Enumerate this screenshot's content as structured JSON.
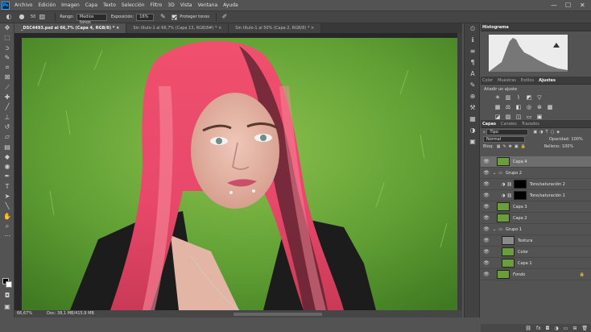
{
  "app": {
    "logo": "Ps"
  },
  "menu": [
    "Archivo",
    "Edición",
    "Imagen",
    "Capa",
    "Texto",
    "Selección",
    "Filtro",
    "3D",
    "Vista",
    "Ventana",
    "Ayuda"
  ],
  "window_controls": {
    "minimize": "—",
    "maximize": "☐",
    "close": "✕"
  },
  "options": {
    "brush_size": "50",
    "range_label": "Rango:",
    "range_value": "Medios tonos",
    "exposure_label": "Exposición:",
    "exposure_value": "16%",
    "protect_label": "Proteger tonos"
  },
  "doc_tabs": [
    {
      "label": "_DSC4493.psd al 66,7% (Capa 4, RGB/8) * ×"
    },
    {
      "label": "Sin título-1 al 66,7% (Capa 13, RGB/8#) * ×"
    },
    {
      "label": "Sin título-1 al 50% (Capa 2, RGB/8) * ×"
    }
  ],
  "status": {
    "zoom": "66,67%",
    "doc": "Doc: 38,1 MB/415,9 MB"
  },
  "histogram": {
    "tab": "Histograma"
  },
  "adjust": {
    "tabs": [
      "Color",
      "Muestras",
      "Estilos",
      "Ajustes"
    ],
    "title": "Añadir un ajuste"
  },
  "layers_panel": {
    "tabs": [
      "Capas",
      "Canales",
      "Trazados"
    ],
    "filter_label": "Tipo",
    "blend_mode": "Normal",
    "opacity_label": "Opacidad:",
    "opacity_value": "100%",
    "lock_label": "Bloq:",
    "fill_label": "Relleno:",
    "fill_value": "100%",
    "layers": [
      {
        "name": "Capa 4"
      },
      {
        "name": "Grupo 2"
      },
      {
        "name": "Tono/saturación 2"
      },
      {
        "name": "Tono/saturación 1"
      },
      {
        "name": "Capa 3"
      },
      {
        "name": "Capa 2"
      },
      {
        "name": "Grupo 1"
      },
      {
        "name": "Textura"
      },
      {
        "name": "Color"
      },
      {
        "name": "Capa 1"
      },
      {
        "name": "Fondo"
      }
    ]
  },
  "colors": {
    "hair": "#e8486a",
    "grass": "#6aa83a",
    "panel": "#535353"
  }
}
